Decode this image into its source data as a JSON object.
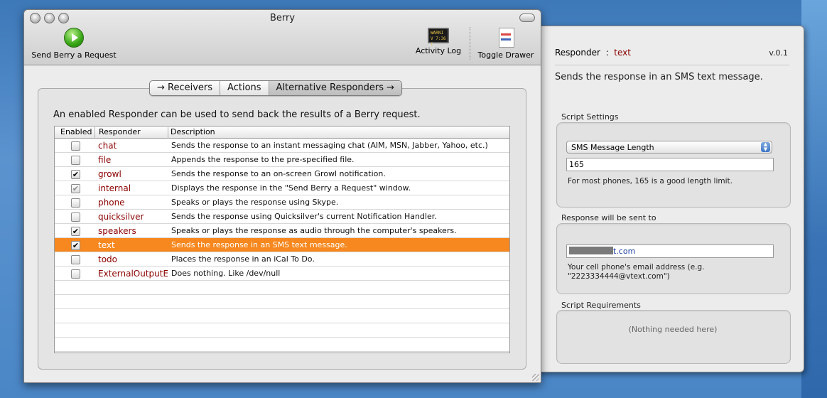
{
  "window": {
    "title": "Berry"
  },
  "toolbar": {
    "send_label": "Send Berry a Request",
    "activity_label": "Activity Log",
    "drawer_label": "Toggle Drawer",
    "activity_icon_text": "WARNI V 7:36 ("
  },
  "tabs": [
    {
      "label": "→  Receivers"
    },
    {
      "label": "Actions"
    },
    {
      "label": "Alternative Responders  →"
    }
  ],
  "intro": "An enabled Responder can be used to send back the results of a Berry request.",
  "table": {
    "headers": [
      "Enabled",
      "Responder",
      "Description"
    ],
    "rows": [
      {
        "checked": false,
        "name": "chat",
        "desc": "Sends the response to an instant messaging chat (AIM, MSN, Jabber, Yahoo, etc.)"
      },
      {
        "checked": false,
        "name": "file",
        "desc": "Appends the response to the pre-specified file."
      },
      {
        "checked": true,
        "name": "growl",
        "desc": "Sends the response to an on-screen Growl notification."
      },
      {
        "checked": true,
        "name": "internal",
        "desc": "Displays the response in the \"Send Berry a Request\" window.",
        "dim": true
      },
      {
        "checked": false,
        "name": "phone",
        "desc": "Speaks or plays the response using Skype."
      },
      {
        "checked": false,
        "name": "quicksilver",
        "desc": "Sends the response using Quicksilver's current Notification Handler."
      },
      {
        "checked": true,
        "name": "speakers",
        "desc": "Speaks or plays the response as audio through the computer's speakers."
      },
      {
        "checked": true,
        "name": "text",
        "desc": "Sends the response in an SMS text message.",
        "selected": true
      },
      {
        "checked": false,
        "name": "todo",
        "desc": "Places the response in an iCal To Do."
      },
      {
        "checked": false,
        "name": "ExternalOutputE",
        "desc": "Does nothing. Like /dev/null"
      }
    ],
    "empty_rows": 6
  },
  "drawer": {
    "responder_label": "Responder",
    "responder_sep": ":",
    "responder_value": "text",
    "version": "v.0.1",
    "description": "Sends the response in an SMS text message.",
    "script_settings_label": "Script Settings",
    "popup_value": "SMS Message Length",
    "length_value": "165",
    "length_hint": "For most phones, 165 is a good length limit.",
    "response_label": "Response will be sent to",
    "email_suffix": "t.com",
    "email_hint": "Your cell phone's email address (e.g. \"2223334444@vtext.com\")",
    "requirements_label": "Script Requirements",
    "requirements_value": "(Nothing needed here)"
  },
  "colors": {
    "selection": "#f6881f",
    "responder_name": "#8b0000"
  }
}
